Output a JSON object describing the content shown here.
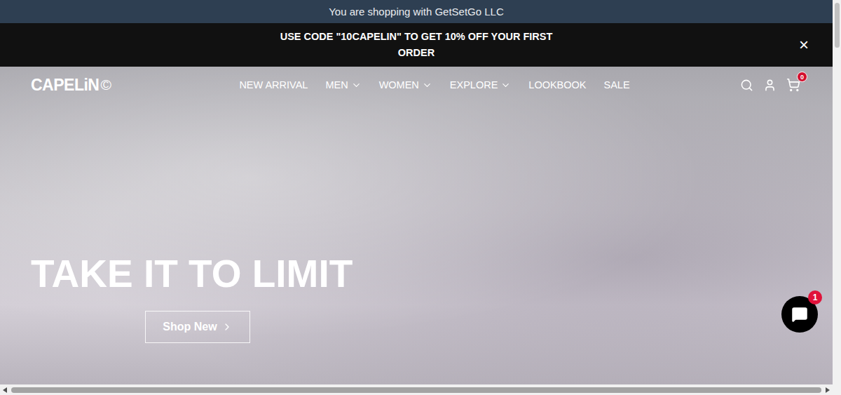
{
  "announcement": {
    "text": "You are shopping with GetSetGo LLC"
  },
  "promo": {
    "text": "USE CODE \"10CAPELIN\" TO GET 10% OFF YOUR FIRST ORDER",
    "close": "×"
  },
  "header": {
    "logo": "CAPELiN",
    "logo_mark": "©",
    "nav": [
      {
        "label": "NEW ARRIVAL",
        "dropdown": false
      },
      {
        "label": "MEN",
        "dropdown": true
      },
      {
        "label": "WOMEN",
        "dropdown": true
      },
      {
        "label": "EXPLORE",
        "dropdown": true
      },
      {
        "label": "LOOKBOOK",
        "dropdown": false
      },
      {
        "label": "SALE",
        "dropdown": false
      }
    ],
    "cart_count": "0"
  },
  "hero": {
    "headline": "TAKE IT TO LIMIT",
    "button": "Shop New"
  },
  "chat": {
    "badge": "1"
  }
}
